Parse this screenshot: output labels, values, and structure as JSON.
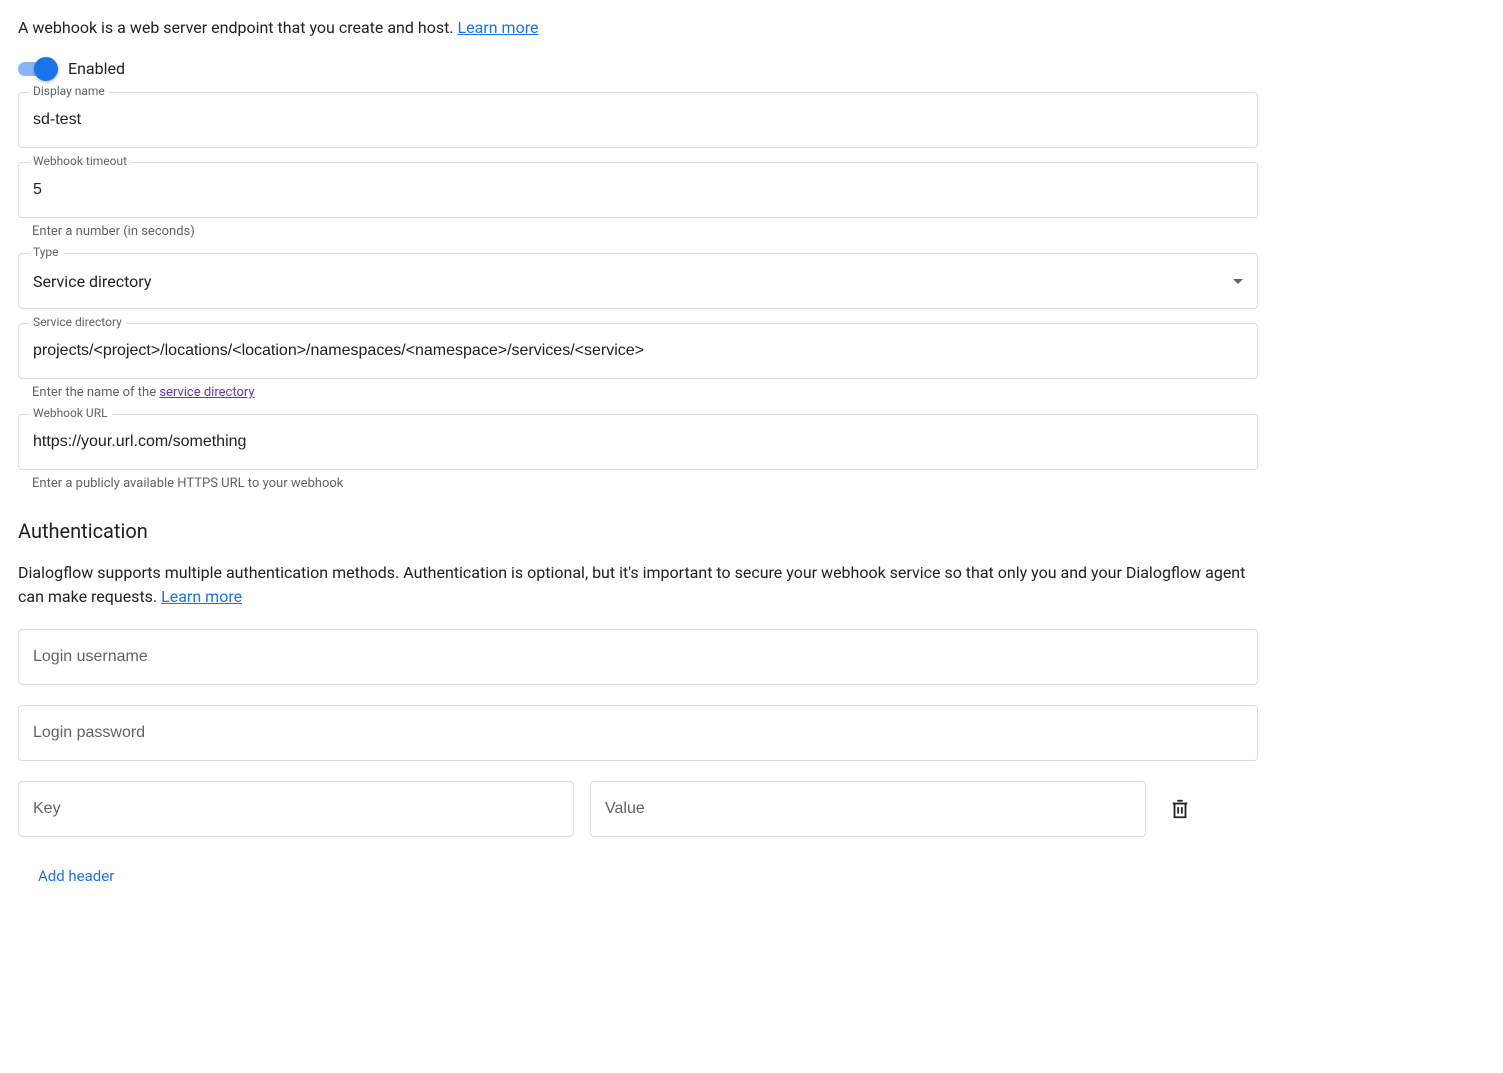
{
  "intro": {
    "text": "A webhook is a web server endpoint that you create and host. ",
    "learn_more": "Learn more"
  },
  "toggle": {
    "enabled": true,
    "label": "Enabled"
  },
  "display_name": {
    "label": "Display name",
    "value": "sd-test"
  },
  "webhook_timeout": {
    "label": "Webhook timeout",
    "value": "5",
    "hint": "Enter a number (in seconds)"
  },
  "type_field": {
    "label": "Type",
    "value": "Service directory"
  },
  "service_directory": {
    "label": "Service directory",
    "value": "projects/<project>/locations/<location>/namespaces/<namespace>/services/<service>",
    "hint_prefix": "Enter the name of the ",
    "hint_link": "service directory"
  },
  "webhook_url": {
    "label": "Webhook URL",
    "value": "https://your.url.com/something",
    "hint": "Enter a publicly available HTTPS URL to your webhook"
  },
  "auth": {
    "title": "Authentication",
    "desc_prefix": "Dialogflow supports multiple authentication methods. Authentication is optional, but it's important to secure your webhook service so that only you and your Dialogflow agent can make requests. ",
    "learn_more": "Learn more",
    "username_placeholder": "Login username",
    "password_placeholder": "Login password",
    "header_key_placeholder": "Key",
    "header_value_placeholder": "Value",
    "add_header_label": "Add header"
  }
}
